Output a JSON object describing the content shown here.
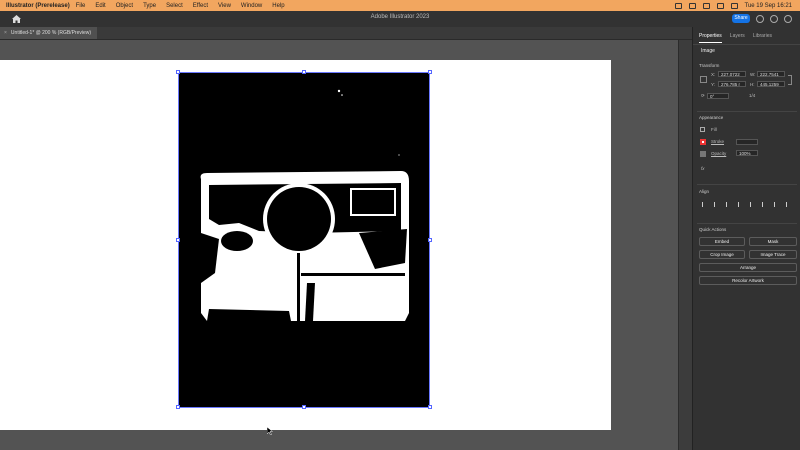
{
  "menubar": {
    "app_name": "Illustrator (Prerelease)",
    "items": [
      "File",
      "Edit",
      "Object",
      "Type",
      "Select",
      "Effect",
      "View",
      "Window",
      "Help"
    ],
    "clock": "Tue 19 Sep  16:21"
  },
  "appbar": {
    "title": "Adobe Illustrator 2023",
    "share_label": "Share"
  },
  "document": {
    "tab_label": "Untitled-1* @ 200 % (RGB/Preview)",
    "close_glyph": "×"
  },
  "panel": {
    "tabs": [
      "Properties",
      "Layers",
      "Libraries"
    ],
    "selection_type": "Image",
    "transform": {
      "heading": "Transform",
      "x_label": "X:",
      "x_value": "227.0722",
      "y_label": "Y:",
      "y_value": "276.785 r",
      "w_label": "W:",
      "w_value": "222.7541",
      "h_label": "H:",
      "h_value": "445.1259",
      "angle_value": "0°",
      "ratio_value": "1/4"
    },
    "appearance": {
      "heading": "Appearance",
      "fill_label": "Fill",
      "stroke_label": "Stroke",
      "opacity_label": "Opacity",
      "opacity_value": "100%",
      "fx_label": "fx"
    },
    "align": {
      "heading": "Align"
    },
    "quick_actions": {
      "heading": "Quick Actions",
      "embed_label": "Embed",
      "mask_label": "Mask",
      "crop_label": "Crop Image",
      "trace_label": "Image Trace",
      "arrange_label": "Arrange",
      "recolor_label": "Recolor Artwork"
    }
  },
  "colors": {
    "menubar_bg": "#f2a65f",
    "share_blue": "#1473e6",
    "selection_blue": "#6a78ff"
  }
}
